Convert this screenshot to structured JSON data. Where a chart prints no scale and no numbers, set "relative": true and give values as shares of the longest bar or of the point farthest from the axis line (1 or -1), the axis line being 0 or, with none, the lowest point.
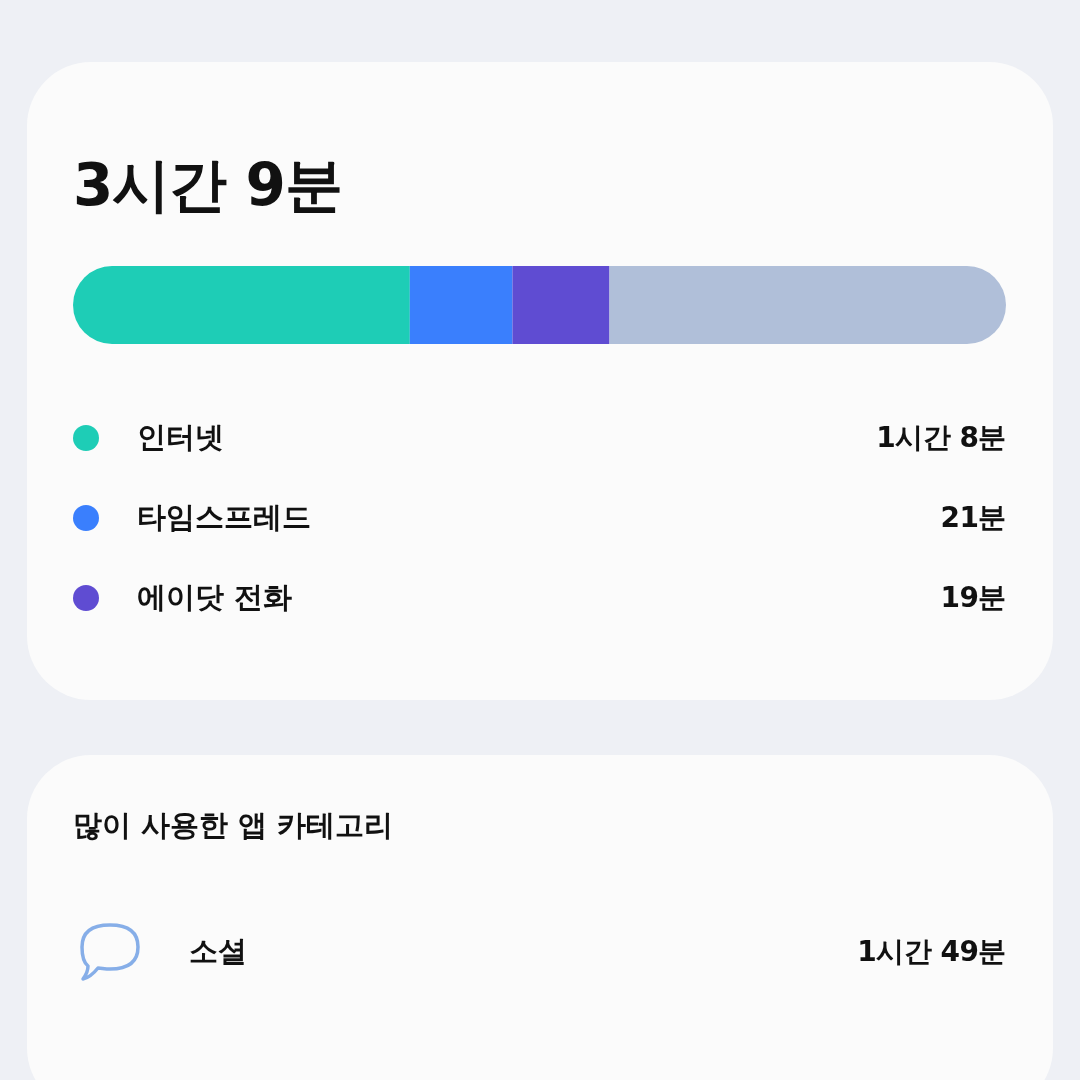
{
  "summary": {
    "total": "3시간 9분",
    "chart_data": {
      "type": "bar",
      "orientation": "horizontal",
      "stacked": true,
      "relative": true,
      "series": [
        {
          "name": "인터넷",
          "color": "#1ecdb6",
          "values": [
            0.361
          ]
        },
        {
          "name": "타임스프레드",
          "color": "#3a7ffd",
          "values": [
            0.11
          ]
        },
        {
          "name": "에이닷 전화",
          "color": "#5f4cd2",
          "values": [
            0.104
          ]
        },
        {
          "color": "#b0bfd9",
          "values": [
            0.425
          ]
        }
      ],
      "value_labels": [
        "1시간 8분",
        "21분",
        "19분"
      ]
    }
  },
  "top_categories": {
    "title": "많이 사용한 앱 카테고리",
    "items": [
      {
        "name": "소셜",
        "time": "1시간 49분"
      }
    ]
  }
}
